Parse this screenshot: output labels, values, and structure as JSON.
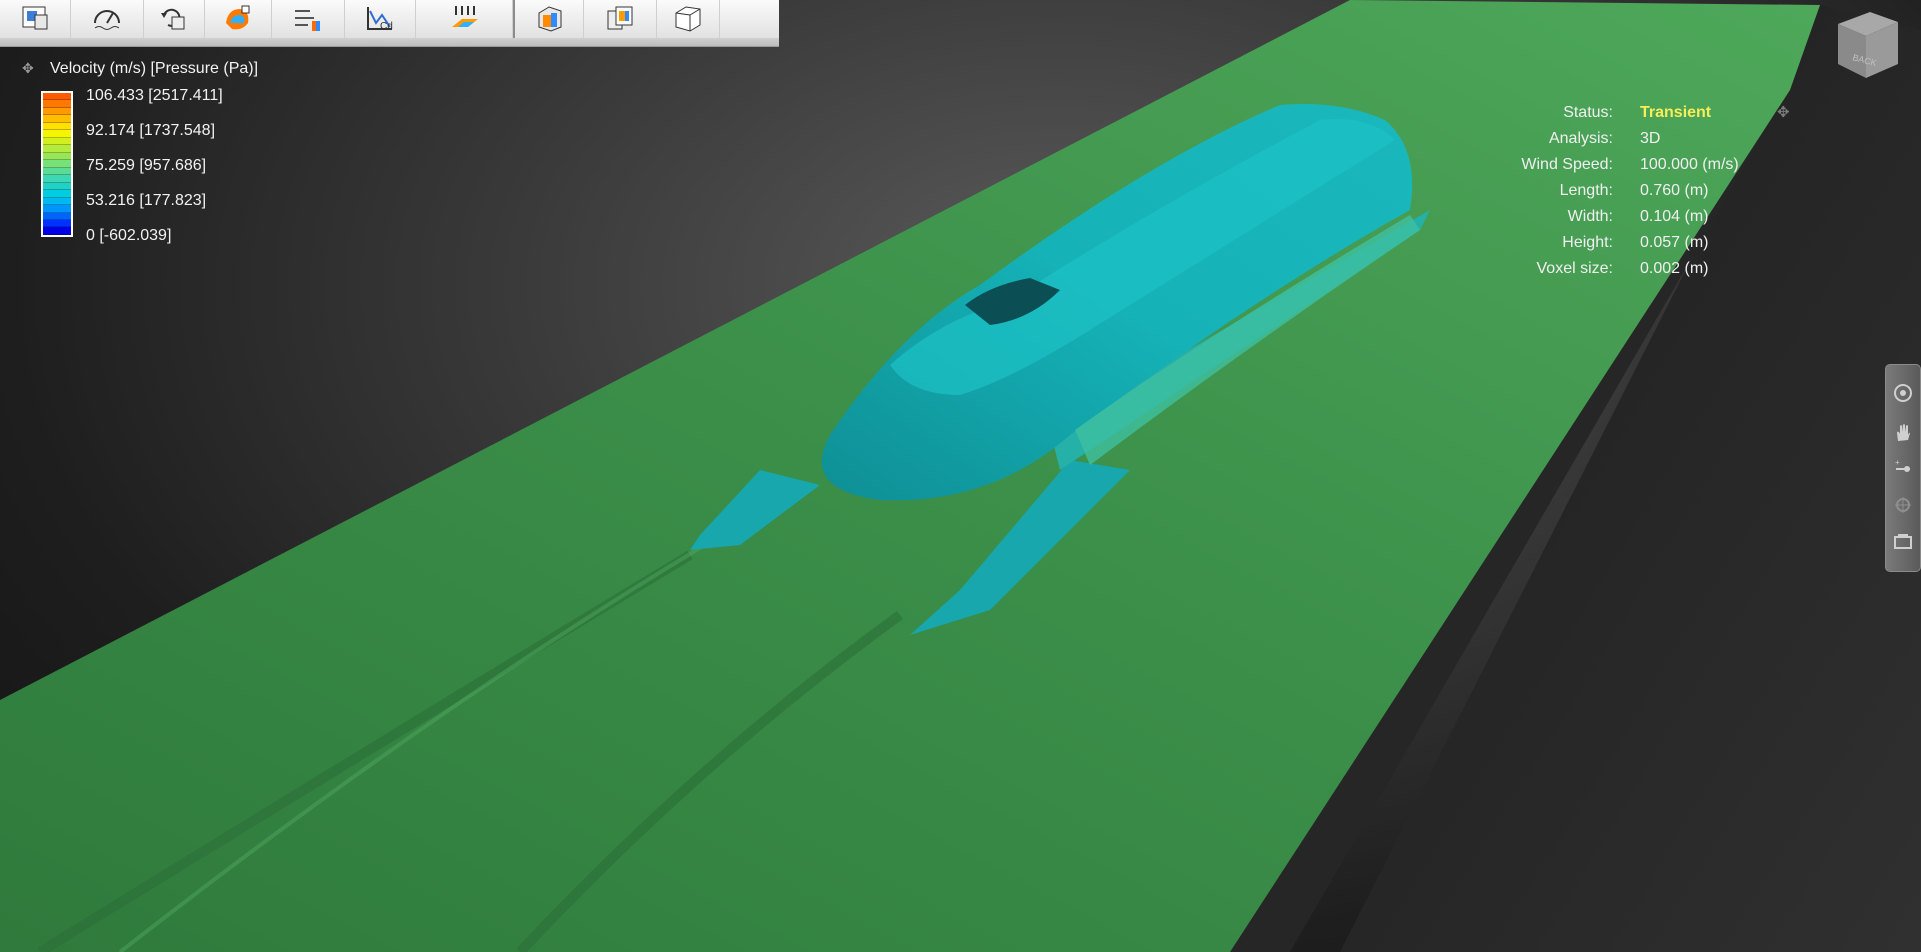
{
  "toolbar": {
    "buttons": [
      {
        "icon": "analysis-settings-icon",
        "dropdown": false
      },
      {
        "icon": "wind-speed-gauge-icon",
        "dropdown": false
      },
      {
        "icon": "rotate-model-icon",
        "dropdown": false
      },
      {
        "icon": "surface-results-icon",
        "dropdown": true
      },
      {
        "icon": "flow-lines-icon",
        "dropdown": true
      },
      {
        "icon": "drag-coefficient-plot-icon",
        "dropdown": false
      },
      {
        "icon": "pressure-plane-icon",
        "dropdown": false
      },
      {
        "icon": "wind-tunnel-box-icon",
        "dropdown": true
      },
      {
        "icon": "result-views-icon",
        "dropdown": false
      },
      {
        "icon": "view-cube-display-icon",
        "dropdown": true
      }
    ]
  },
  "legend": {
    "title": "Velocity (m/s) [Pressure (Pa)]",
    "labels": [
      "106.433 [2517.411]",
      "92.174 [1737.548]",
      "75.259 [957.686]",
      "53.216 [177.823]",
      "0 [-602.039]"
    ],
    "colors": [
      "#ff5a00",
      "#ff7800",
      "#ff9a00",
      "#ffbf00",
      "#ffe100",
      "#f5f500",
      "#d2f01e",
      "#b4eb3c",
      "#96e65a",
      "#78e178",
      "#5adc96",
      "#3cd7b4",
      "#1ed2c8",
      "#00cde1",
      "#00b9f0",
      "#0096ff",
      "#0064ff",
      "#0032ff",
      "#0000e6"
    ]
  },
  "status": {
    "rows": [
      {
        "key": "Status:",
        "value": "Transient",
        "highlight": true
      },
      {
        "key": "Analysis:",
        "value": "3D"
      },
      {
        "key": "Wind Speed:",
        "value": "100.000 (m/s)"
      },
      {
        "key": "Length:",
        "value": "0.760 (m)"
      },
      {
        "key": "Width:",
        "value": "0.104 (m)"
      },
      {
        "key": "Height:",
        "value": "0.057 (m)"
      },
      {
        "key": "Voxel size:",
        "value": "0.002 (m)"
      }
    ]
  },
  "viewcube": {
    "face_label": "BACK"
  },
  "sidenav": {
    "icons": [
      "orbit-icon",
      "pan-hand-icon",
      "zoom-slider-icon",
      "look-around-icon",
      "camera-views-icon"
    ]
  },
  "colors": {
    "ground": "#3e8f4c",
    "model": "#16b4b8",
    "status_highlight": "#f6ee5a"
  }
}
